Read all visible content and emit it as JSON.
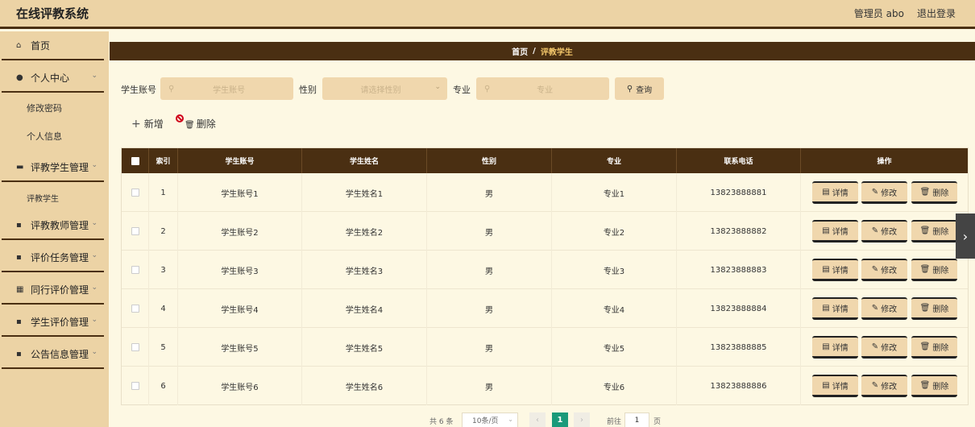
{
  "header": {
    "app_title": "在线评教系统",
    "user_label": "管理员 abo",
    "logout_label": "退出登录"
  },
  "sidebar": {
    "menus": [
      {
        "label": "首页",
        "icon": "home-icon",
        "glyph": "⌂"
      },
      {
        "label": "个人中心",
        "icon": "user-icon",
        "glyph": "●"
      },
      {
        "label": "评教学生管理",
        "icon": "briefcase-icon",
        "glyph": "▬"
      },
      {
        "label": "评教教师管理",
        "icon": "grid-icon",
        "glyph": "▪"
      },
      {
        "label": "评价任务管理",
        "icon": "document-icon",
        "glyph": "▪"
      },
      {
        "label": "同行评价管理",
        "icon": "table-icon",
        "glyph": "▦"
      },
      {
        "label": "学生评价管理",
        "icon": "grid-icon",
        "glyph": "▪"
      },
      {
        "label": "公告信息管理",
        "icon": "grid-icon",
        "glyph": "▪"
      }
    ],
    "sub_personal": [
      "修改密码",
      "个人信息"
    ],
    "sub_student": [
      "评教学生"
    ]
  },
  "breadcrumb": {
    "home": "首页",
    "separator": "/",
    "current": "评教学生"
  },
  "search": {
    "account_label": "学生账号",
    "account_placeholder": "学生账号",
    "gender_label": "性别",
    "gender_placeholder": "请选择性别",
    "major_label": "专业",
    "major_placeholder": "专业",
    "query_label": "查询"
  },
  "actions": {
    "add_label": "新增",
    "delete_label": "删除"
  },
  "table": {
    "columns": [
      "",
      "索引",
      "学生账号",
      "学生姓名",
      "性别",
      "专业",
      "联系电话",
      "操作"
    ],
    "rows": [
      {
        "index": "1",
        "account": "学生账号1",
        "name": "学生姓名1",
        "gender": "男",
        "major": "专业1",
        "phone": "13823888881"
      },
      {
        "index": "2",
        "account": "学生账号2",
        "name": "学生姓名2",
        "gender": "男",
        "major": "专业2",
        "phone": "13823888882"
      },
      {
        "index": "3",
        "account": "学生账号3",
        "name": "学生姓名3",
        "gender": "男",
        "major": "专业3",
        "phone": "13823888883"
      },
      {
        "index": "4",
        "account": "学生账号4",
        "name": "学生姓名4",
        "gender": "男",
        "major": "专业4",
        "phone": "13823888884"
      },
      {
        "index": "5",
        "account": "学生账号5",
        "name": "学生姓名5",
        "gender": "男",
        "major": "专业5",
        "phone": "13823888885"
      },
      {
        "index": "6",
        "account": "学生账号6",
        "name": "学生姓名6",
        "gender": "男",
        "major": "专业6",
        "phone": "13823888886"
      }
    ],
    "op_detail": "详情",
    "op_edit": "修改",
    "op_delete": "删除"
  },
  "pagination": {
    "total_text": "共 6 条",
    "page_size": "10条/页",
    "current_page": "1",
    "goto_label": "前往",
    "goto_value": "1",
    "page_unit": "页"
  },
  "colors": {
    "accent_dark": "#4a2f12",
    "panel": "#ecd3a5",
    "button": "#f0d7ad",
    "background": "#fdf8e3",
    "page_active": "#1a9a7a"
  }
}
